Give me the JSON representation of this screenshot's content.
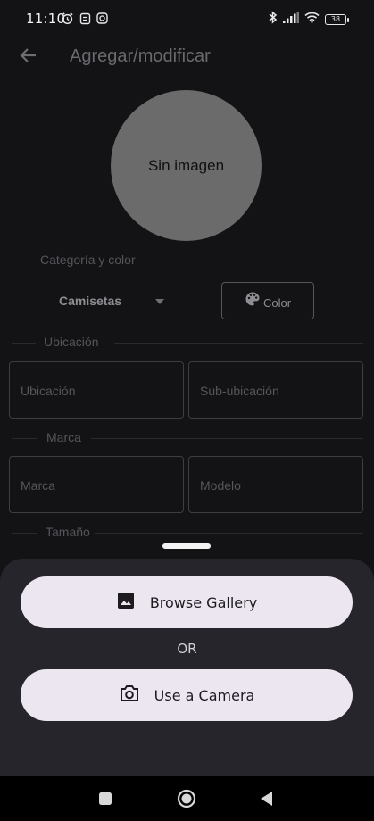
{
  "status_bar": {
    "time": "11:10",
    "battery": "38",
    "left_icons": [
      "alarm-icon",
      "notification-s-icon",
      "instagram-icon"
    ],
    "right_icons": [
      "bluetooth-icon",
      "signal-icon",
      "wifi-icon",
      "battery-icon"
    ]
  },
  "app_bar": {
    "title": "Agregar/modificar",
    "back_icon": "arrow-back-icon"
  },
  "image": {
    "placeholder": "Sin imagen"
  },
  "sections": {
    "category_color": "Categoría y color",
    "location": "Ubicación",
    "brand": "Marca",
    "size": "Tamaño"
  },
  "category": {
    "value": "Camisetas"
  },
  "color_button": {
    "label": "Color",
    "icon": "palette-icon"
  },
  "fields": {
    "location": "Ubicación",
    "sub_location": "Sub-ubicación",
    "brand": "Marca",
    "model": "Modelo"
  },
  "bottom_sheet": {
    "gallery_label": "Browse Gallery",
    "gallery_icon": "image-icon",
    "or_label": "OR",
    "camera_label": "Use a Camera",
    "camera_icon": "camera-icon"
  },
  "nav_bar": {
    "items": [
      "recents-square-icon",
      "home-circle-icon",
      "back-triangle-icon"
    ]
  },
  "colors": {
    "background": "#131316",
    "sheet": "#26252b",
    "sheet_button": "#ece6f0",
    "placeholder_circle": "#6b6b6b"
  }
}
